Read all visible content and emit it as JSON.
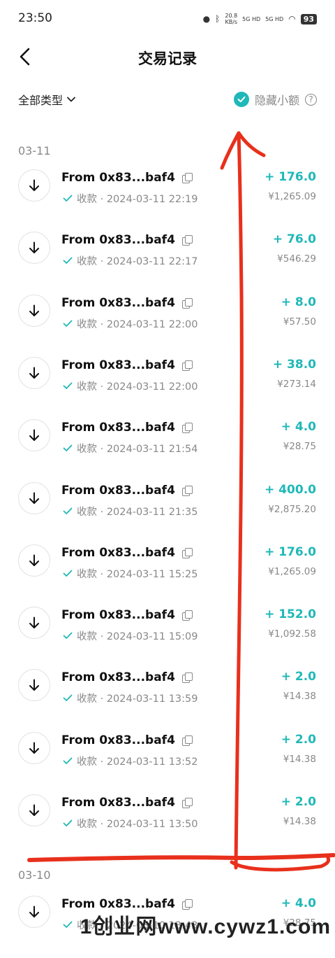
{
  "status_bar": {
    "time": "23:50",
    "speed": "20.8",
    "speed_unit": "KB/s",
    "net1": "5G HD",
    "net2": "5G HD",
    "battery": "93"
  },
  "header": {
    "title": "交易记录"
  },
  "filter": {
    "type_label": "全部类型",
    "hide_small_label": "隐藏小额",
    "help_symbol": "?"
  },
  "accent_color": "#1fb8b8",
  "groups": [
    {
      "date": "03-11",
      "transactions": [
        {
          "from": "From 0x83...baf4",
          "status": "收款 · 2024-03-11 22:19",
          "amount": "+ 176.0",
          "fiat": "¥1,265.09"
        },
        {
          "from": "From 0x83...baf4",
          "status": "收款 · 2024-03-11 22:17",
          "amount": "+ 76.0",
          "fiat": "¥546.29"
        },
        {
          "from": "From 0x83...baf4",
          "status": "收款 · 2024-03-11 22:00",
          "amount": "+ 8.0",
          "fiat": "¥57.50"
        },
        {
          "from": "From 0x83...baf4",
          "status": "收款 · 2024-03-11 22:00",
          "amount": "+ 38.0",
          "fiat": "¥273.14"
        },
        {
          "from": "From 0x83...baf4",
          "status": "收款 · 2024-03-11 21:54",
          "amount": "+ 4.0",
          "fiat": "¥28.75"
        },
        {
          "from": "From 0x83...baf4",
          "status": "收款 · 2024-03-11 21:35",
          "amount": "+ 400.0",
          "fiat": "¥2,875.20"
        },
        {
          "from": "From 0x83...baf4",
          "status": "收款 · 2024-03-11 15:25",
          "amount": "+ 176.0",
          "fiat": "¥1,265.09"
        },
        {
          "from": "From 0x83...baf4",
          "status": "收款 · 2024-03-11 15:09",
          "amount": "+ 152.0",
          "fiat": "¥1,092.58"
        },
        {
          "from": "From 0x83...baf4",
          "status": "收款 · 2024-03-11 13:59",
          "amount": "+ 2.0",
          "fiat": "¥14.38"
        },
        {
          "from": "From 0x83...baf4",
          "status": "收款 · 2024-03-11 13:52",
          "amount": "+ 2.0",
          "fiat": "¥14.38"
        },
        {
          "from": "From 0x83...baf4",
          "status": "收款 · 2024-03-11 13:50",
          "amount": "+ 2.0",
          "fiat": "¥14.38"
        }
      ]
    },
    {
      "date": "03-10",
      "transactions": [
        {
          "from": "From 0x83...baf4",
          "status": "收款 · 2024-03-10 13:43",
          "amount": "+ 4.0",
          "fiat": "¥28.75"
        }
      ]
    }
  ],
  "watermark": "1创业网www.cywz1.com"
}
